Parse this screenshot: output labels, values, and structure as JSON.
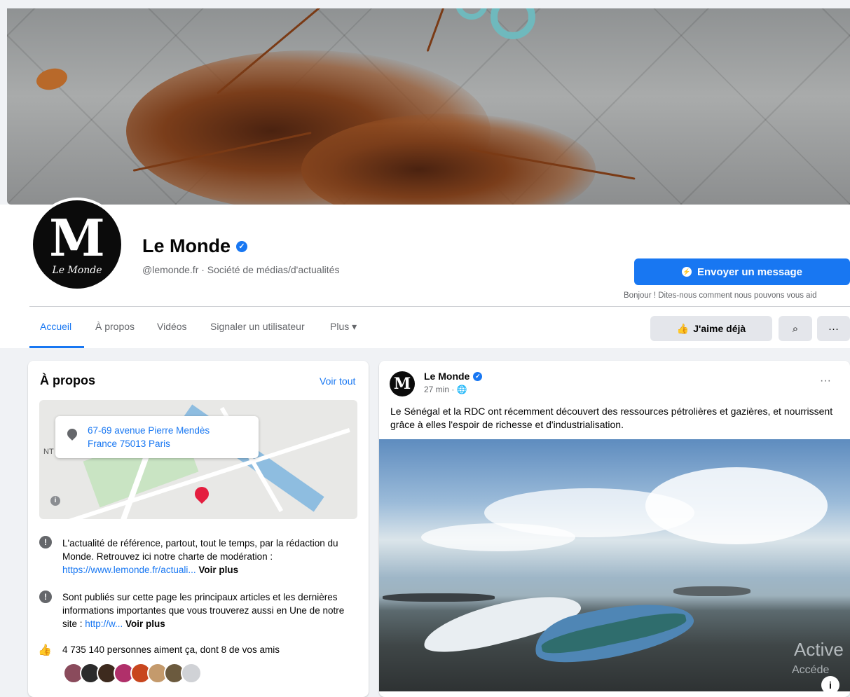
{
  "page": {
    "name": "Le Monde",
    "subtitle": "@lemonde.fr · Société de médias/d'actualités",
    "avatar_text": "M",
    "avatar_caption": "Le Monde"
  },
  "actions": {
    "message_button": "Envoyer un message",
    "greeting": "Bonjour ! Dites-nous comment nous pouvons vous aid",
    "like_button": "J'aime déjà",
    "search_icon": "⌕",
    "more_icon": "···"
  },
  "tabs": [
    {
      "label": "Accueil",
      "active": true
    },
    {
      "label": "À propos"
    },
    {
      "label": "Vidéos"
    },
    {
      "label": "Signaler un utilisateur"
    },
    {
      "label": "Plus ▾"
    }
  ],
  "about": {
    "title": "À propos",
    "see_all": "Voir tout",
    "address_line1": "67-69 avenue Pierre Mendès",
    "address_line2": "France 75013 Paris",
    "map_labels": [
      "NT"
    ],
    "info1_text": "L'actualité de référence, partout, tout le temps, par la rédaction du Monde. Retrouvez ici notre charte de modération : ",
    "info1_link": "https://www.lemonde.fr/actuali...",
    "info1_more": " Voir plus",
    "info2_text": "Sont publiés sur cette page les principaux articles et les dernières informations importantes que vous trouverez aussi en Une de notre site : ",
    "info2_link": "http://w...",
    "info2_more": " Voir plus",
    "likes_text": "4 735 140 personnes aiment ça, dont 8 de vos amis"
  },
  "post": {
    "author": "Le Monde",
    "time": "27 min · 🌐",
    "more": "···",
    "text": "Le Sénégal et la RDC ont récemment découvert des ressources pétrolières et gazières, et nourrissent grâce à elles l'espoir de richesse et d'industrialisation.",
    "image_info": "i"
  },
  "overlay": {
    "activate_line1": "Active",
    "activate_line2": "Accéde"
  },
  "colors": {
    "accent": "#1877f2",
    "background": "#f0f2f5"
  }
}
